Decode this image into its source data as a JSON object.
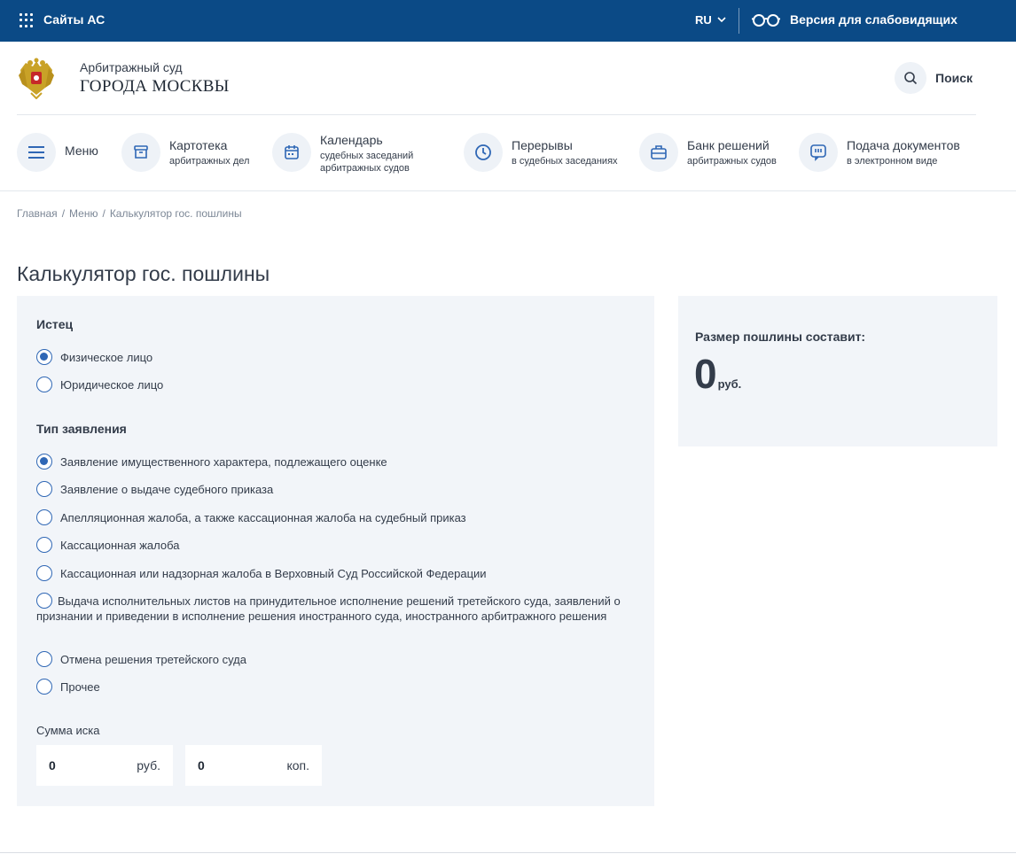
{
  "topbar": {
    "sites_label": "Сайты АС",
    "lang": "RU",
    "vision_label": "Версия для слабовидящих"
  },
  "header": {
    "court_small": "Арбитражный суд",
    "court_big": "ГОРОДА МОСКВЫ",
    "search_label": "Поиск"
  },
  "nav": {
    "menu": {
      "title": "Меню"
    },
    "kartoteka": {
      "title": "Картотека",
      "sub": "арбитражных дел"
    },
    "calendar": {
      "title": "Календарь",
      "sub1": "судебных заседаний",
      "sub2": "арбитражных судов"
    },
    "breaks": {
      "title": "Перерывы",
      "sub": "в судебных заседаниях"
    },
    "bank": {
      "title": "Банк решений",
      "sub": "арбитражных судов"
    },
    "filing": {
      "title": "Подача документов",
      "sub": "в электронном виде"
    }
  },
  "breadcrumb": {
    "home": "Главная",
    "menu": "Меню",
    "current": "Калькулятор гос. пошлины",
    "sep": "/"
  },
  "page_title": "Калькулятор гос. пошлины",
  "form": {
    "plaintiff_title": "Истец",
    "plaintiff_options": [
      {
        "label": "Физическое лицо",
        "checked": true
      },
      {
        "label": "Юридическое лицо",
        "checked": false
      }
    ],
    "type_title": "Тип заявления",
    "type_options": [
      {
        "label": "Заявление имущественного характера, подлежащего оценке",
        "checked": true
      },
      {
        "label": "Заявление о выдаче судебного приказа",
        "checked": false
      },
      {
        "label": "Апелляционная жалоба, а также кассационная жалоба на судебный приказ",
        "checked": false
      },
      {
        "label": "Кассационная жалоба",
        "checked": false
      },
      {
        "label": "Кассационная или надзорная жалоба в Верховный Суд Российской Федерации",
        "checked": false
      },
      {
        "label": "Выдача исполнительных листов на принудительное исполнение решений третейского суда, заявлений о признании и приведении в исполнение решения иностранного суда, иностранного арбитражного решения",
        "checked": false
      },
      {
        "label": "Отмена решения третейского суда",
        "checked": false
      },
      {
        "label": "Прочее",
        "checked": false
      }
    ],
    "sum_label": "Сумма иска",
    "rub_value": "0",
    "rub_unit": "руб.",
    "kop_value": "0",
    "kop_unit": "коп."
  },
  "result": {
    "label": "Размер пошлины составит:",
    "value": "0",
    "currency": "руб."
  },
  "colors": {
    "topbar_bg": "#0b4a86",
    "panel_bg": "#f2f5f9",
    "accent": "#2f67b5",
    "icon_bg": "#eef2f7"
  }
}
